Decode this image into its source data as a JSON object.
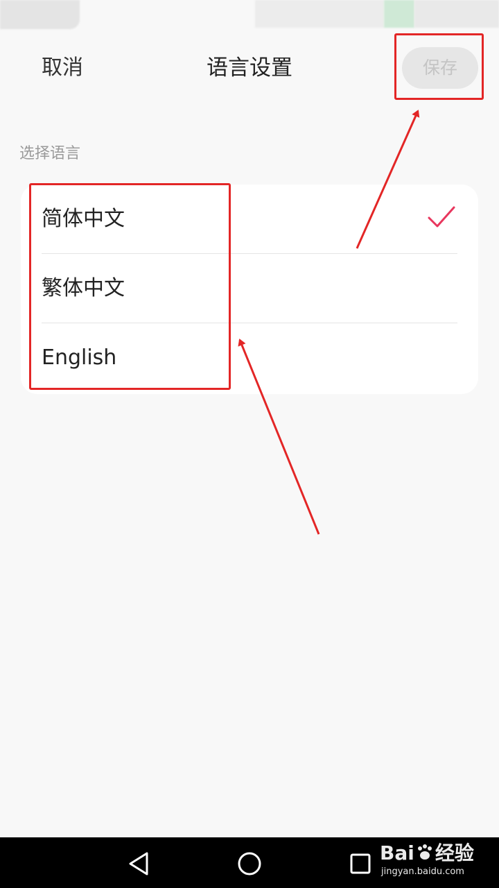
{
  "header": {
    "cancel_label": "取消",
    "title": "语言设置",
    "save_label": "保存"
  },
  "section": {
    "label": "选择语言"
  },
  "languages": [
    {
      "label": "简体中文",
      "selected": true
    },
    {
      "label": "繁体中文",
      "selected": false
    },
    {
      "label": "English",
      "selected": false
    }
  ],
  "colors": {
    "accent": "#e8365d",
    "annotation": "#e32626",
    "save_disabled_bg": "#e6e6e6",
    "save_disabled_text": "#c4c4c4"
  },
  "icons": {
    "check": "check-icon",
    "nav_back": "triangle-back-icon",
    "nav_home": "circle-home-icon",
    "nav_recents": "square-recents-icon"
  },
  "watermark": {
    "brand_left": "Bai",
    "brand_right": "经验",
    "url": "jingyan.baidu.com"
  }
}
